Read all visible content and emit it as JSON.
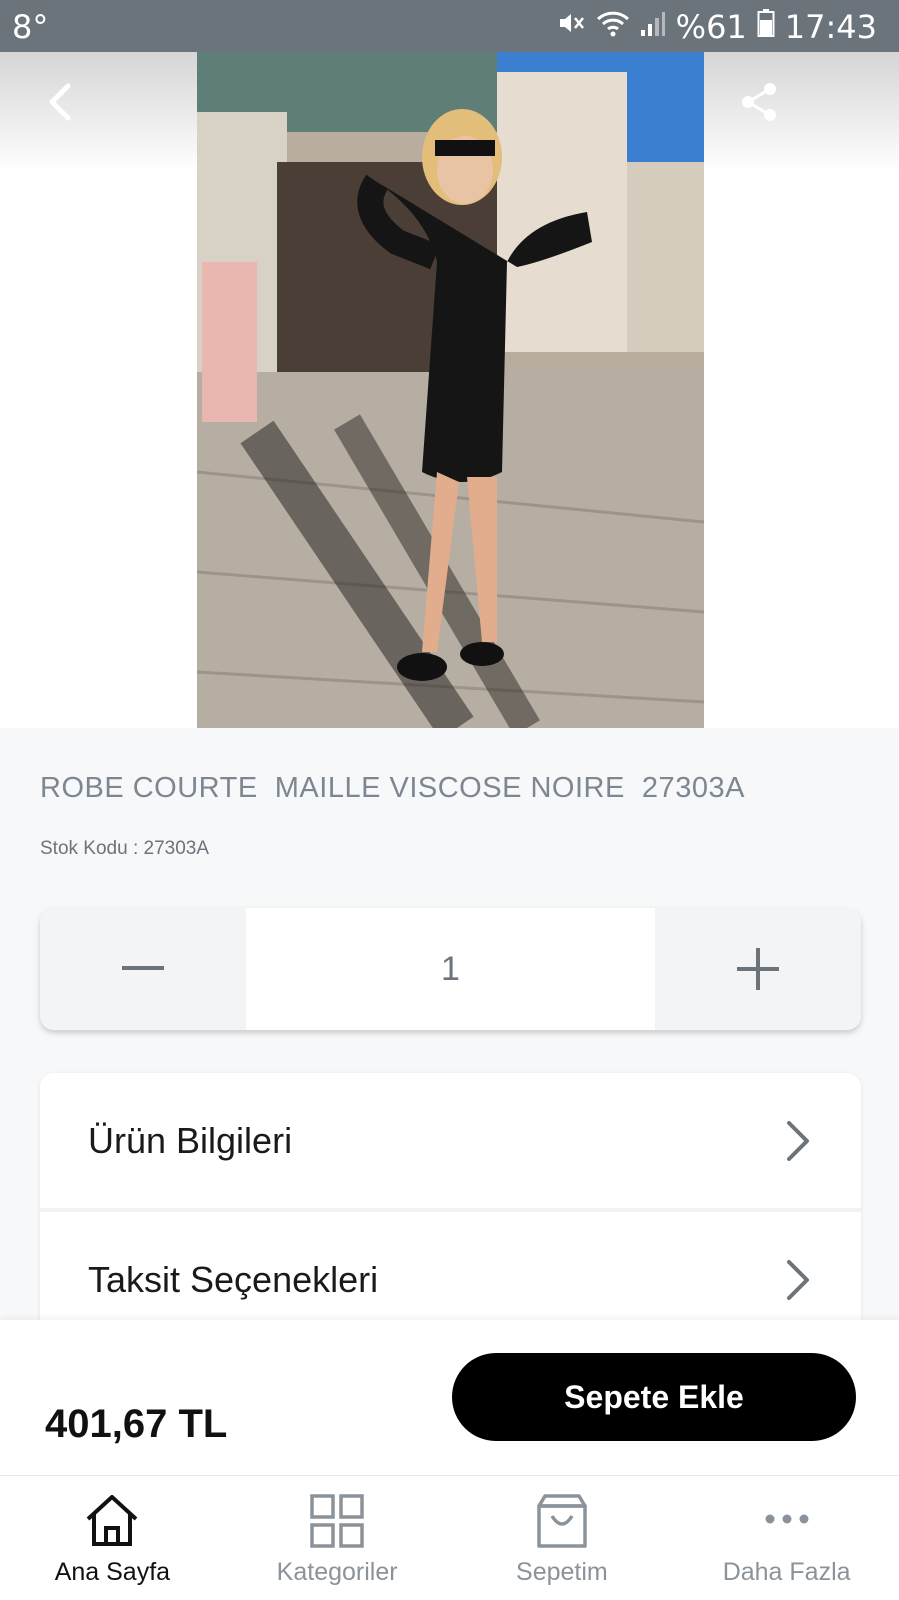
{
  "status_bar": {
    "temperature": "8°",
    "battery": "%61",
    "time": "17:43"
  },
  "header": {
    "back_icon": "chevron-left-icon",
    "share_icon": "share-icon"
  },
  "product": {
    "title": "ROBE COURTE  MAILLE VISCOSE NOIRE  27303A",
    "sku_label": "Stok Kodu : ",
    "sku_value": "27303A"
  },
  "quantity": {
    "value": "1",
    "minus_icon": "minus-icon",
    "plus_icon": "plus-icon"
  },
  "info_rows": [
    {
      "label": "Ürün Bilgileri"
    },
    {
      "label": "Taksit Seçenekleri"
    }
  ],
  "buy": {
    "price": "401,67 TL",
    "add_to_cart": "Sepete Ekle"
  },
  "tabs": [
    {
      "label": "Ana Sayfa",
      "icon": "home-icon",
      "active": true
    },
    {
      "label": "Kategoriler",
      "icon": "grid-icon",
      "active": false
    },
    {
      "label": "Sepetim",
      "icon": "bag-icon",
      "active": false
    },
    {
      "label": "Daha Fazla",
      "icon": "more-icon",
      "active": false
    }
  ],
  "colors": {
    "accent": "#000000",
    "muted_text": "#7d8791",
    "status_bar": "#6b737b"
  }
}
